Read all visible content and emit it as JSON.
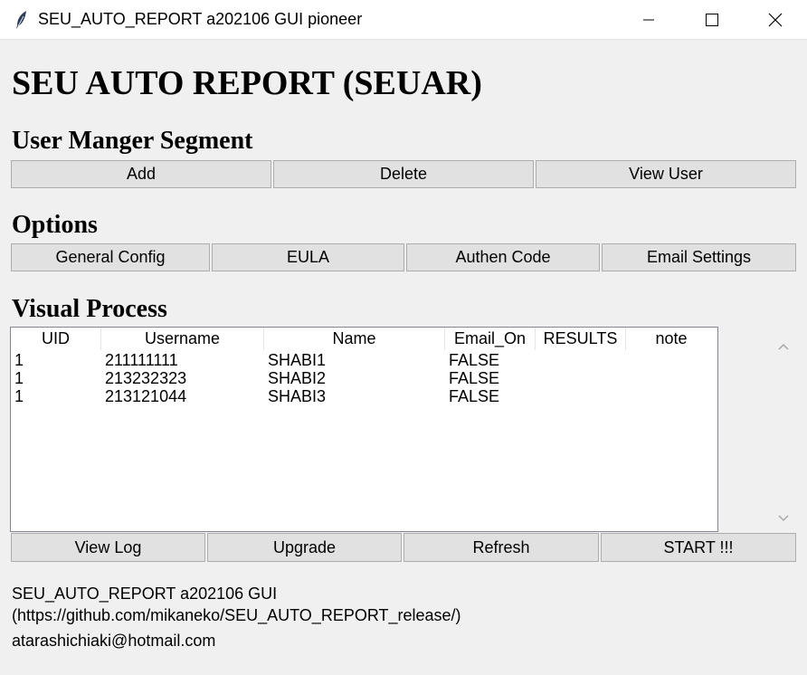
{
  "window": {
    "title": "SEU_AUTO_REPORT a202106 GUI pioneer"
  },
  "header": {
    "title": "SEU AUTO REPORT (SEUAR)"
  },
  "user_manager": {
    "heading": "User Manger Segment",
    "buttons": [
      "Add",
      "Delete",
      "View User"
    ]
  },
  "options": {
    "heading": "Options",
    "buttons": [
      "General Config",
      "EULA",
      "Authen Code",
      "Email Settings"
    ]
  },
  "visual_process": {
    "heading": "Visual Process",
    "columns": [
      "UID",
      "Username",
      "Name",
      "Email_On",
      "RESULTS",
      "note"
    ],
    "rows": [
      [
        "1",
        "211111111",
        "SHABI1",
        "FALSE",
        "",
        ""
      ],
      [
        "1",
        "213232323",
        "SHABI2",
        "FALSE",
        "",
        ""
      ],
      [
        "1",
        "213121044",
        "SHABI3",
        "FALSE",
        "",
        ""
      ]
    ]
  },
  "actions": {
    "buttons": [
      "View Log",
      "Upgrade",
      "Refresh",
      "START !!!"
    ]
  },
  "footer": {
    "line1": "SEU_AUTO_REPORT a202106 GUI",
    "line2": "(https://github.com/mikaneko/SEU_AUTO_REPORT_release/)",
    "email": "atarashichiaki@hotmail.com"
  },
  "icons": {
    "app": "feather-icon",
    "minimize": "minimize-icon",
    "maximize": "maximize-icon",
    "close": "close-icon",
    "scroll_up": "chevron-up-icon",
    "scroll_down": "chevron-down-icon"
  },
  "colors": {
    "background": "#f0f0f0",
    "button": "#e1e1e1",
    "button_border": "#adadad",
    "table_bg": "#ffffff"
  }
}
